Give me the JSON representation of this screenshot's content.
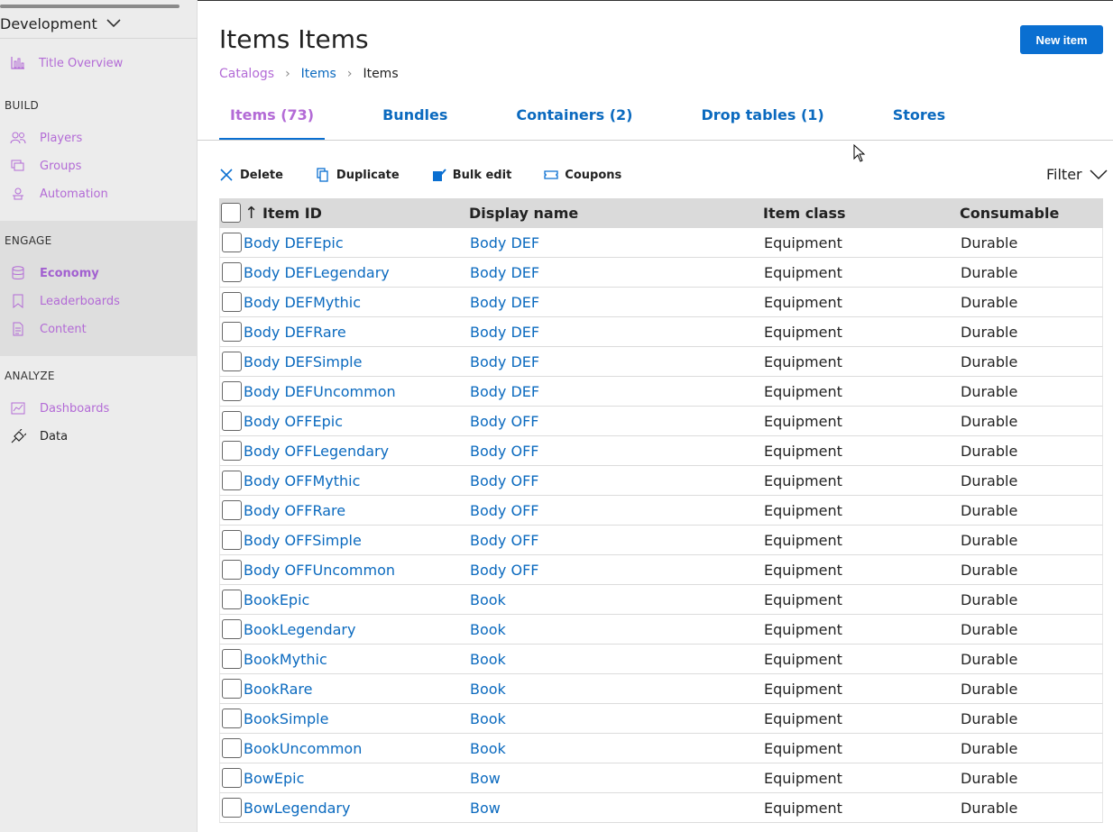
{
  "sidebar": {
    "environment": "Development",
    "title_overview": "Title Overview",
    "sections": {
      "build": "BUILD",
      "engage": "ENGAGE",
      "analyze": "ANALYZE"
    },
    "items": {
      "players": "Players",
      "groups": "Groups",
      "automation": "Automation",
      "economy": "Economy",
      "leaderboards": "Leaderboards",
      "content": "Content",
      "dashboards": "Dashboards",
      "data": "Data"
    }
  },
  "header": {
    "title": "Items Items",
    "new_button": "New item",
    "breadcrumb": [
      "Catalogs",
      "Items",
      "Items"
    ]
  },
  "tabs": [
    {
      "label": "Items (73)",
      "active": true
    },
    {
      "label": "Bundles",
      "active": false
    },
    {
      "label": "Containers (2)",
      "active": false
    },
    {
      "label": "Drop tables (1)",
      "active": false
    },
    {
      "label": "Stores",
      "active": false
    }
  ],
  "toolbar": {
    "delete": "Delete",
    "duplicate": "Duplicate",
    "bulk_edit": "Bulk edit",
    "coupons": "Coupons",
    "filter": "Filter"
  },
  "table": {
    "columns": [
      "Item ID",
      "Display name",
      "Item class",
      "Consumable"
    ],
    "rows": [
      [
        "Body DEFEpic",
        "Body DEF",
        "Equipment",
        "Durable"
      ],
      [
        "Body DEFLegendary",
        "Body DEF",
        "Equipment",
        "Durable"
      ],
      [
        "Body DEFMythic",
        "Body DEF",
        "Equipment",
        "Durable"
      ],
      [
        "Body DEFRare",
        "Body DEF",
        "Equipment",
        "Durable"
      ],
      [
        "Body DEFSimple",
        "Body DEF",
        "Equipment",
        "Durable"
      ],
      [
        "Body DEFUncommon",
        "Body DEF",
        "Equipment",
        "Durable"
      ],
      [
        "Body OFFEpic",
        "Body OFF",
        "Equipment",
        "Durable"
      ],
      [
        "Body OFFLegendary",
        "Body OFF",
        "Equipment",
        "Durable"
      ],
      [
        "Body OFFMythic",
        "Body OFF",
        "Equipment",
        "Durable"
      ],
      [
        "Body OFFRare",
        "Body OFF",
        "Equipment",
        "Durable"
      ],
      [
        "Body OFFSimple",
        "Body OFF",
        "Equipment",
        "Durable"
      ],
      [
        "Body OFFUncommon",
        "Body OFF",
        "Equipment",
        "Durable"
      ],
      [
        "BookEpic",
        "Book",
        "Equipment",
        "Durable"
      ],
      [
        "BookLegendary",
        "Book",
        "Equipment",
        "Durable"
      ],
      [
        "BookMythic",
        "Book",
        "Equipment",
        "Durable"
      ],
      [
        "BookRare",
        "Book",
        "Equipment",
        "Durable"
      ],
      [
        "BookSimple",
        "Book",
        "Equipment",
        "Durable"
      ],
      [
        "BookUncommon",
        "Book",
        "Equipment",
        "Durable"
      ],
      [
        "BowEpic",
        "Bow",
        "Equipment",
        "Durable"
      ],
      [
        "BowLegendary",
        "Bow",
        "Equipment",
        "Durable"
      ]
    ]
  },
  "colors": {
    "accent_blue": "#0a6fd1",
    "link_blue": "#0b6abf",
    "nav_purple": "#b36bd6"
  }
}
